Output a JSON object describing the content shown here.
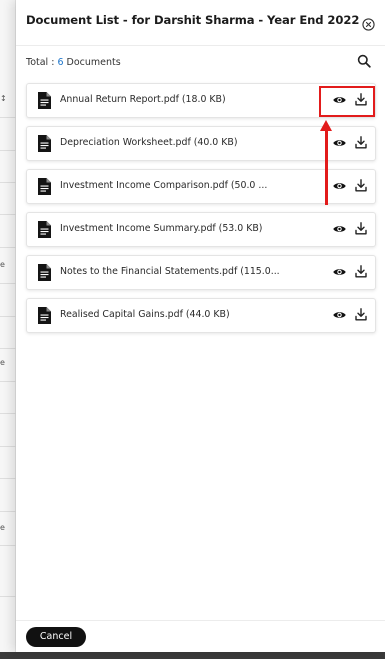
{
  "header": {
    "title": "Document List - for Darshit Sharma - Year End 2022"
  },
  "summary": {
    "total_label": "Total :",
    "count": "6",
    "unit": "Documents"
  },
  "documents": [
    {
      "name": "Annual Return Report.pdf (18.0 KB)"
    },
    {
      "name": "Depreciation Worksheet.pdf (40.0 KB)"
    },
    {
      "name": "Investment Income Comparison.pdf (50.0 ..."
    },
    {
      "name": "Investment Income Summary.pdf (53.0 KB)"
    },
    {
      "name": "Notes to the Financial Statements.pdf (115.0..."
    },
    {
      "name": "Realised Capital Gains.pdf (44.0 KB)"
    }
  ],
  "footer": {
    "cancel_label": "Cancel"
  },
  "background": {
    "glyphs": [
      "↕",
      "e",
      "e",
      "e"
    ]
  },
  "icons": {
    "close": "close-circle-icon",
    "search": "search-icon",
    "file": "file-document-icon",
    "view": "eye-icon",
    "download": "download-icon"
  },
  "colors": {
    "accent": "#1a73c9",
    "highlight": "#e21b1b",
    "button": "#111111"
  }
}
